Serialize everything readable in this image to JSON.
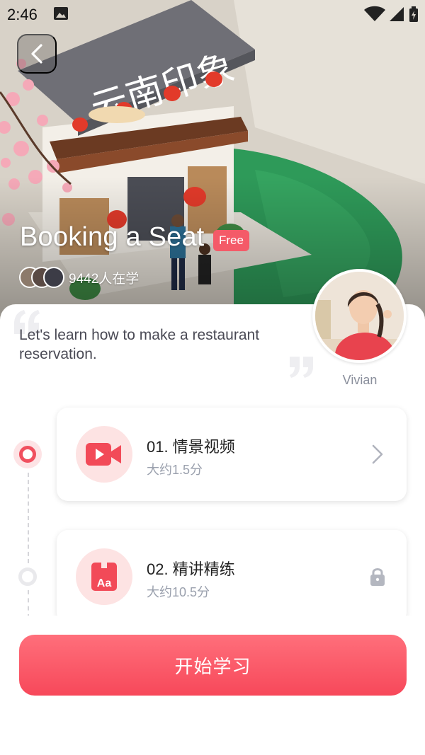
{
  "status_bar": {
    "time": "2:46",
    "icons": [
      "image-icon",
      "wifi-icon",
      "signal-icon",
      "battery-charging-icon"
    ]
  },
  "hero": {
    "sign_text": "云南印象",
    "title": "Booking a Seat",
    "badge": "Free",
    "learners_text": "9442人在学"
  },
  "intro": {
    "text": "Let's learn how to make a restaurant reservation.",
    "teacher": "Vivian"
  },
  "steps": [
    {
      "title": "01. 情景视频",
      "duration": "大约1.5分",
      "icon": "video-icon",
      "action_icon": "chevron-right-icon",
      "state": "active"
    },
    {
      "title": "02. 精讲精练",
      "duration": "大约10.5分",
      "icon": "vocabulary-book-icon",
      "icon_text": "Aa",
      "action_icon": "lock-icon",
      "state": "locked"
    }
  ],
  "cta": {
    "label": "开始学习"
  },
  "colors": {
    "accent": "#f45a68",
    "accent_light": "#fde3e3",
    "muted_text": "#9aa0ad"
  }
}
